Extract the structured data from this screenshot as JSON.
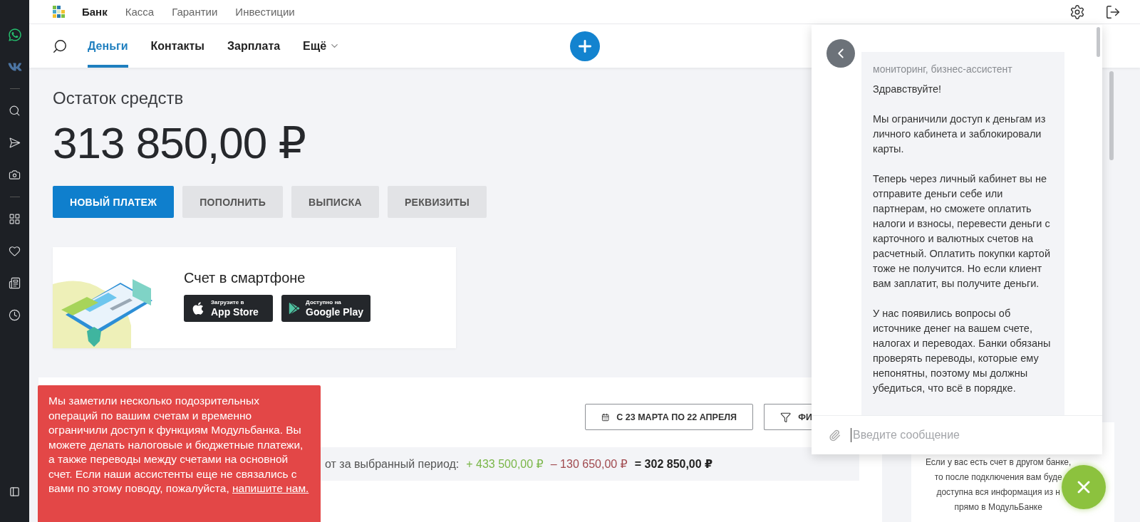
{
  "top_nav": {
    "items": [
      {
        "label": "Банк",
        "selected": true
      },
      {
        "label": "Касса",
        "selected": false
      },
      {
        "label": "Гарантии",
        "selected": false
      },
      {
        "label": "Инвестиции",
        "selected": false
      }
    ]
  },
  "main_nav": {
    "tabs": [
      {
        "label": "Деньги",
        "selected": true
      },
      {
        "label": "Контакты",
        "selected": false
      },
      {
        "label": "Зарплата",
        "selected": false
      }
    ],
    "more": "Ещё"
  },
  "balance": {
    "title": "Остаток средств",
    "amount": "313 850,00 ₽"
  },
  "actions": [
    {
      "label": "НОВЫЙ ПЛАТЕЖ",
      "kind": "primary"
    },
    {
      "label": "ПОПОЛНИТЬ",
      "kind": "secondary"
    },
    {
      "label": "ВЫПИСКА",
      "kind": "secondary"
    },
    {
      "label": "РЕКВИЗИТЫ",
      "kind": "secondary"
    }
  ],
  "promo": {
    "title": "Счет в смартфоне",
    "stores": [
      {
        "kind": "apple",
        "caption": "Загрузите в",
        "name": "App Store"
      },
      {
        "kind": "google",
        "caption": "Доступно на",
        "name": "Google Play"
      }
    ]
  },
  "operations": {
    "period": "С 23 МАРТА ПО 22 АПРЕЛЯ",
    "filter": "ФИ",
    "summary": {
      "label": "от за выбранный период:",
      "income": "+ 433 500,00 ₽",
      "expense": "– 130 650,00 ₽",
      "total": "= 302 850,00 ₽"
    }
  },
  "info_card": {
    "lines": [
      "Если у вас есть счет в другом банке,",
      "то после подключения вам буде",
      "доступна вся информация из н",
      "прямо в МодульБанке"
    ]
  },
  "chat": {
    "sender": "мониторинг, бизнес-ассистент",
    "paragraphs": [
      "Здравствуйте!",
      "Мы ограничили доступ к деньгам из личного кабинета и заблокировали карты.",
      "Теперь через личный кабинет вы не отправите деньги себе или партнерам, но сможете оплатить налоги и взносы, перевести деньги с карточного и валютных счетов на расчетный. Оплатить покупки картой тоже не получится. Но если клиент вам заплатит, вы получите деньги.",
      "У нас появились вопросы об источнике денег на вашем счете, налогах и переводах. Банки обязаны проверять переводы, которые ему непонятны, поэтому мы должны убедиться, что всё в порядке."
    ],
    "placeholder": "Введите сообщение"
  },
  "toast": {
    "text": "Мы заметили несколько подозрительных операций по вашим счетам и временно ограничили доступ к функциям Модульбанка. Вы можете делать налоговые и бюджетные платежи, а также переводы между счетами на основной счет. Если наши ассистенты еще не связались с вами по этому поводу, пожалуйста,",
    "link": "напишите нам."
  }
}
